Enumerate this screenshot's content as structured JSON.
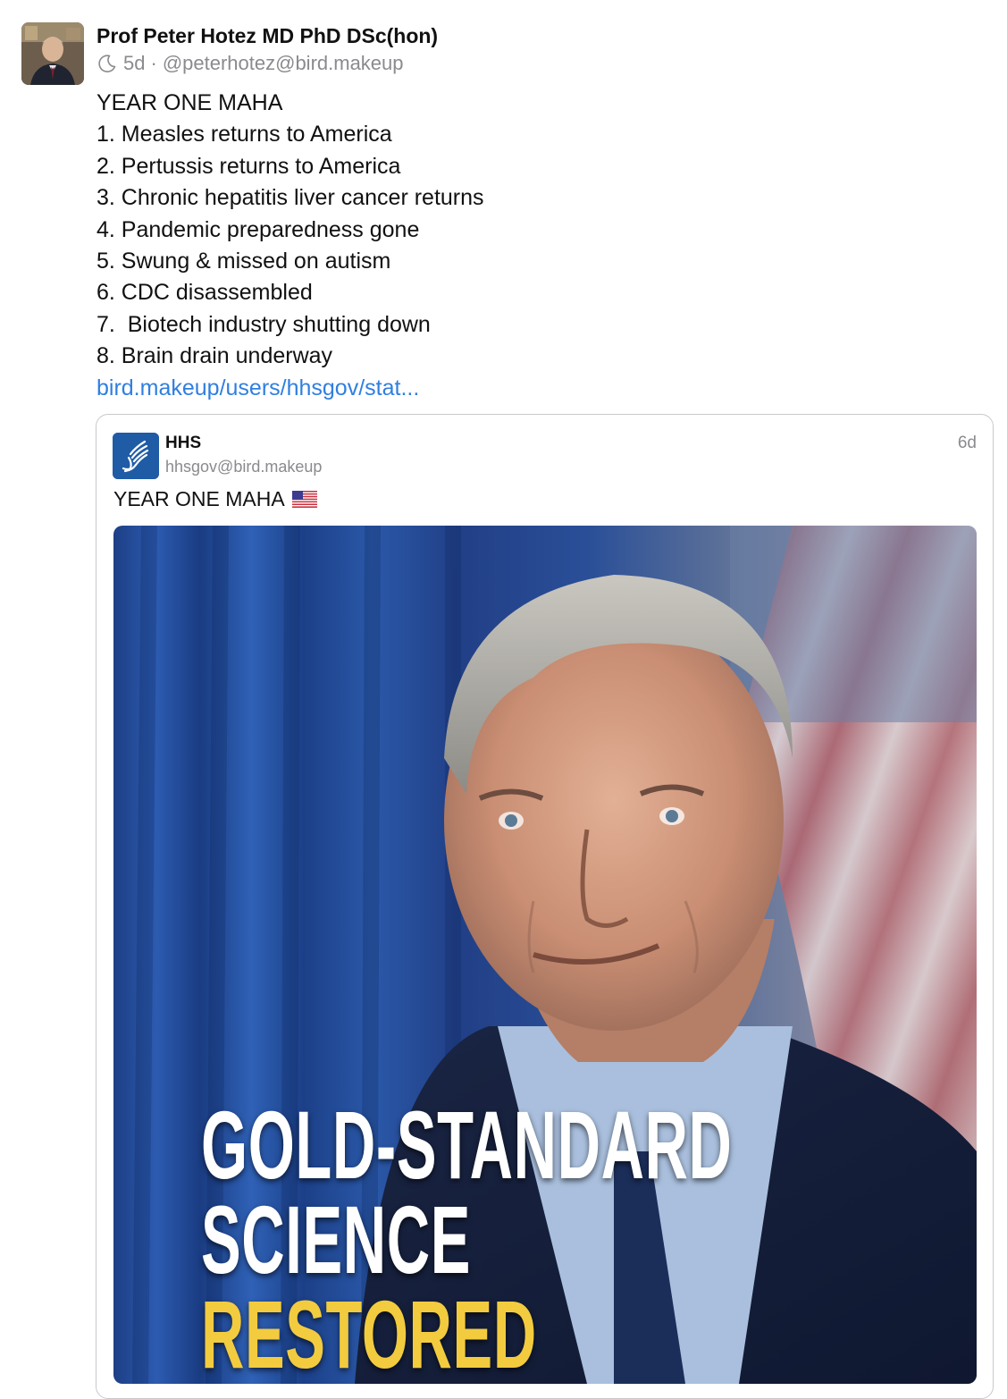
{
  "post": {
    "author_name": "Prof Peter Hotez MD PhD DSc(hon)",
    "age": "5d",
    "separator": "·",
    "handle": "@peterhotez@bird.makeup",
    "lines": [
      "YEAR ONE MAHA",
      "1. Measles returns to America",
      "2. Pertussis returns to America",
      "3. Chronic hepatitis liver cancer returns",
      "4. Pandemic preparedness gone",
      "5. Swung & missed on autism",
      "6. CDC disassembled",
      "7.  Biotech industry shutting down",
      "8. Brain drain underway"
    ],
    "link_text": "bird.makeup/users/hhsgov/stat..."
  },
  "quote": {
    "name": "HHS",
    "handle": "hhsgov@bird.makeup",
    "time": "6d",
    "text": "YEAR ONE MAHA",
    "flag_icon": "us-flag-emoji",
    "image_headline": {
      "line1": "GOLD-STANDARD",
      "line2": "SCIENCE",
      "line3": "RESTORED"
    }
  },
  "colors": {
    "link": "#2f7fe0",
    "meta_gray": "#8a8a8f",
    "hhs_blue": "#1f5ca5",
    "headline_gold": "#f2cb3f"
  }
}
